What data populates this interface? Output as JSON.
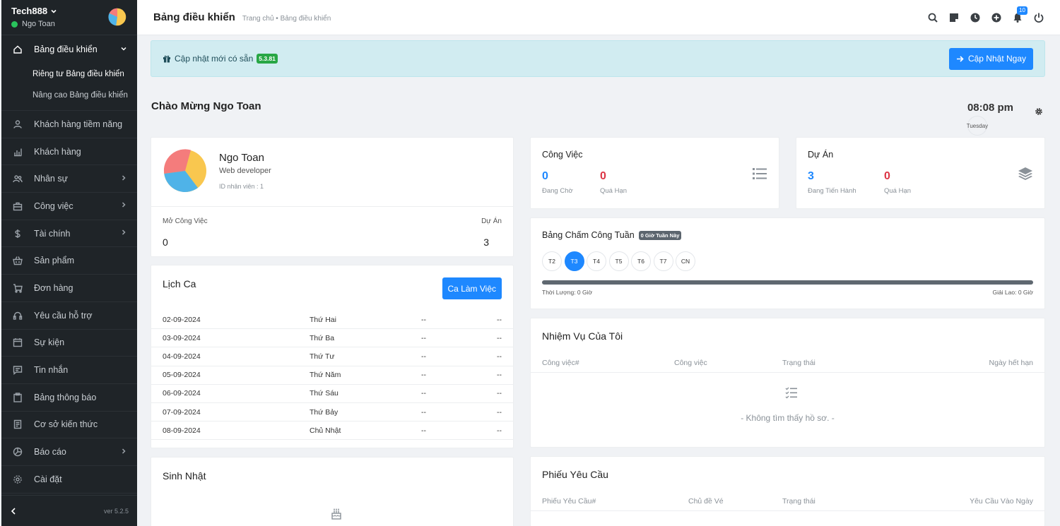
{
  "sidebar": {
    "brand": "Tech888",
    "user": "Ngo Toan",
    "status_color": "#29c35c",
    "version": "ver 5.2.5",
    "items": [
      {
        "label": "Bảng điều khiển",
        "icon": "home-icon",
        "chevron": true
      },
      {
        "label": "Khách hàng tiềm năng",
        "icon": "user-icon",
        "chevron": false
      },
      {
        "label": "Khách hàng",
        "icon": "bar-chart-icon",
        "chevron": false
      },
      {
        "label": "Nhân sự",
        "icon": "users-icon",
        "chevron": true
      },
      {
        "label": "Công việc",
        "icon": "briefcase-icon",
        "chevron": true
      },
      {
        "label": "Tài chính",
        "icon": "dollar-icon",
        "chevron": true
      },
      {
        "label": "Sản phẩm",
        "icon": "basket-icon",
        "chevron": false
      },
      {
        "label": "Đơn hàng",
        "icon": "cart-icon",
        "chevron": false
      },
      {
        "label": "Yêu cầu hỗ trợ",
        "icon": "headset-icon",
        "chevron": false
      },
      {
        "label": "Sự kiện",
        "icon": "calendar-icon",
        "chevron": false
      },
      {
        "label": "Tin nhắn",
        "icon": "message-icon",
        "chevron": false
      },
      {
        "label": "Bảng thông báo",
        "icon": "clipboard-icon",
        "chevron": false
      },
      {
        "label": "Cơ sở kiến thức",
        "icon": "book-icon",
        "chevron": false
      },
      {
        "label": "Báo cáo",
        "icon": "pie-chart-icon",
        "chevron": true
      },
      {
        "label": "Cài đặt",
        "icon": "gear-icon",
        "chevron": false
      }
    ],
    "sub_items": [
      "Riêng tư Bảng điều khiển",
      "Nâng cao Bảng điều khiển"
    ]
  },
  "topbar": {
    "title": "Bảng điều khiển",
    "breadcrumb": "Trang chủ • Bảng điều khiển",
    "notification_count": "10"
  },
  "alert": {
    "text": "Cập nhật mới có sẵn",
    "version": "5.3.81",
    "button": "Cập Nhật Ngay"
  },
  "welcome": "Chào Mừng Ngo Toan",
  "clock": {
    "time": "08:08 pm",
    "day": "Tuesday"
  },
  "profile": {
    "name": "Ngo Toan",
    "role": "Web developer",
    "employee_id": "ID nhân viên : 1",
    "open_tasks_label": "Mở Công Việc",
    "open_tasks_value": "0",
    "projects_label": "Dự Án",
    "projects_value": "3"
  },
  "shift": {
    "title": "Lịch Ca",
    "button": "Ca Làm Việc",
    "rows": [
      {
        "date": "02-09-2024",
        "day": "Thứ Hai",
        "start": "--",
        "end": "--"
      },
      {
        "date": "03-09-2024",
        "day": "Thứ Ba",
        "start": "--",
        "end": "--"
      },
      {
        "date": "04-09-2024",
        "day": "Thứ Tư",
        "start": "--",
        "end": "--"
      },
      {
        "date": "05-09-2024",
        "day": "Thứ Năm",
        "start": "--",
        "end": "--"
      },
      {
        "date": "06-09-2024",
        "day": "Thứ Sáu",
        "start": "--",
        "end": "--"
      },
      {
        "date": "07-09-2024",
        "day": "Thứ Bảy",
        "start": "--",
        "end": "--"
      },
      {
        "date": "08-09-2024",
        "day": "Chủ Nhật",
        "start": "--",
        "end": "--"
      }
    ]
  },
  "birthday": {
    "title": "Sinh Nhật"
  },
  "tasks": {
    "title": "Công Việc",
    "pending_value": "0",
    "pending_label": "Đang Chờ",
    "overdue_value": "0",
    "overdue_label": "Quá Hạn"
  },
  "projects": {
    "title": "Dự Án",
    "progress_value": "3",
    "progress_label": "Đang Tiến Hành",
    "overdue_value": "0",
    "overdue_label": "Quá Hạn"
  },
  "timesheet": {
    "title": "Bảng Chấm Công Tuần",
    "badge": "0 Giờ Tuần Này",
    "days": [
      "T2",
      "T3",
      "T4",
      "T5",
      "T6",
      "T7",
      "CN"
    ],
    "selected_day": "T3",
    "duration": "Thời Lượng: 0 Giờ",
    "break": "Giải Lao: 0 Giờ"
  },
  "my_tasks": {
    "title": "Nhiệm Vụ Của Tôi",
    "columns": [
      "Công việc#",
      "Công việc",
      "Trạng thái",
      "Ngày hết hạn"
    ],
    "empty": "- Không tìm thấy hồ sơ. -"
  },
  "tickets": {
    "title": "Phiếu Yêu Cầu",
    "columns": [
      "Phiếu Yêu Cầu#",
      "Chủ đề Vé",
      "Trạng thái",
      "Yêu Cầu Vào Ngày"
    ]
  },
  "colors": {
    "accent": "#1e88ff",
    "danger": "#dc3545",
    "success": "#28a745",
    "sidebar_bg": "#1f2428",
    "alert_bg": "#d1ecf1"
  }
}
